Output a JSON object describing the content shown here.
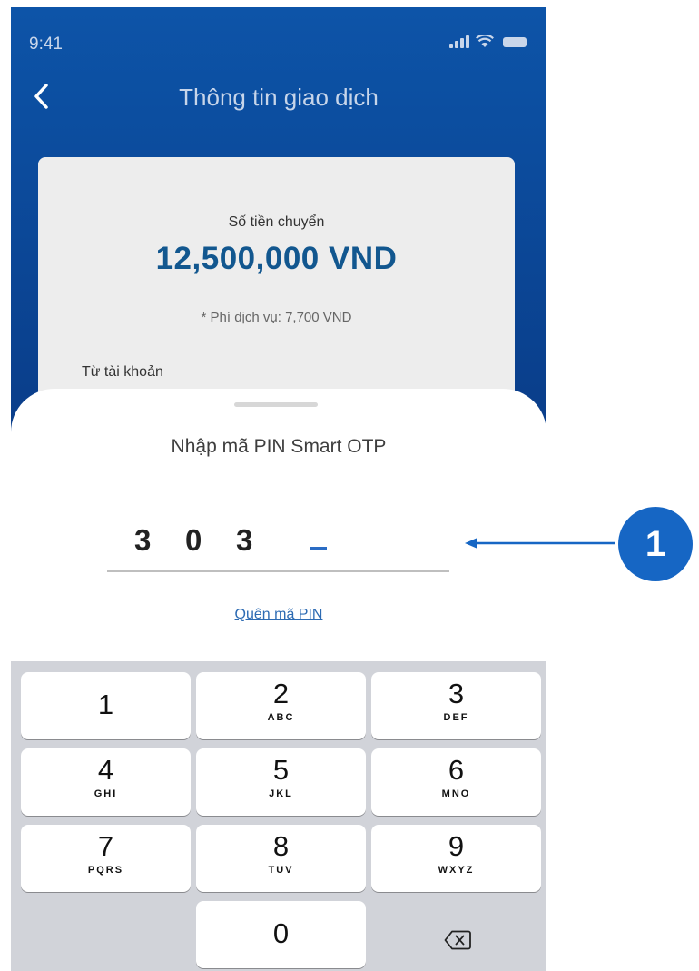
{
  "status_bar": {
    "time": "9:41",
    "icons": [
      "signal-icon",
      "wifi-icon",
      "battery-icon"
    ]
  },
  "nav": {
    "title": "Thông tin giao dịch",
    "back_icon": "chevron-left-icon"
  },
  "transaction": {
    "amount_label": "Số tiền chuyển",
    "amount_value": "12,500,000 VND",
    "fee_text": "* Phí dịch vụ: 7,700 VND",
    "from_label": "Từ tài khoản"
  },
  "pin_sheet": {
    "title": "Nhập mã PIN Smart OTP",
    "digits": [
      "3",
      "0",
      "3"
    ],
    "forgot_link": "Quên mã PIN"
  },
  "keypad": {
    "keys": [
      {
        "digit": "1",
        "letters": ""
      },
      {
        "digit": "2",
        "letters": "ABC"
      },
      {
        "digit": "3",
        "letters": "DEF"
      },
      {
        "digit": "4",
        "letters": "GHI"
      },
      {
        "digit": "5",
        "letters": "JKL"
      },
      {
        "digit": "6",
        "letters": "MNO"
      },
      {
        "digit": "7",
        "letters": "PQRS"
      },
      {
        "digit": "8",
        "letters": "TUV"
      },
      {
        "digit": "9",
        "letters": "WXYZ"
      },
      {
        "digit": "0",
        "letters": ""
      }
    ],
    "delete_icon": "backspace-icon"
  },
  "annotation": {
    "badge": "1"
  },
  "colors": {
    "header_blue": "#0d54a8",
    "amount_blue": "#12578f",
    "link_blue": "#2d6bb3",
    "badge_blue": "#1666c4"
  }
}
